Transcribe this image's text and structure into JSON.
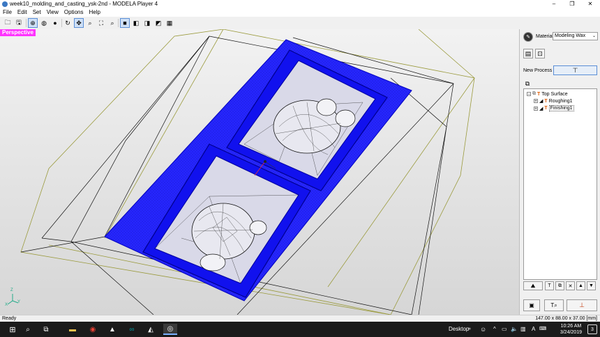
{
  "window": {
    "title": "week10_molding_and_casting_ysk-2nd - MODELA Player 4",
    "minimize": "–",
    "maximize": "❐",
    "close": "✕"
  },
  "menu": [
    "File",
    "Edit",
    "Set",
    "View",
    "Options",
    "Help"
  ],
  "toolbar_icons": [
    "open-icon",
    "save-icon",
    "view-rotate-icon",
    "view-globe-icon",
    "view-sphere-icon",
    "refresh-icon",
    "pan-icon",
    "zoom-in-icon",
    "zoom-fit-icon",
    "zoom-out-icon",
    "view-front-box-icon",
    "view-side-box-icon",
    "view-top-box-icon",
    "view-iso-box-icon",
    "grid-icon"
  ],
  "viewport": {
    "label": "Perspective",
    "axes": {
      "z": "Z",
      "x": "X",
      "y": "Y"
    },
    "mesh_color": "#2323ff"
  },
  "side": {
    "material_label": "Material",
    "material_value": "Modeling Wax",
    "new_process_label": "New Process",
    "tree": [
      {
        "label": "Top Surface",
        "level": 0
      },
      {
        "label": "Roughing1",
        "level": 1
      },
      {
        "label": "Finishing1",
        "level": 1
      }
    ]
  },
  "status": {
    "left": "Ready",
    "right": "147.00 x 88.00 x 37.00 [mm]"
  },
  "taskbar": {
    "desktop_label": "Desktop",
    "time": "10:26 AM",
    "date": "3/24/2019",
    "notifications": "3",
    "ime": "A"
  }
}
